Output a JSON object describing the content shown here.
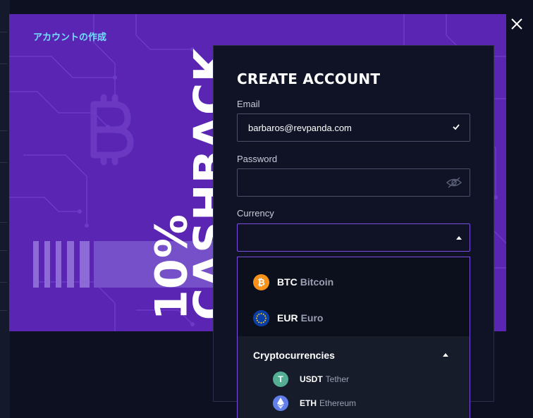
{
  "banner": {
    "title": "アカウントの作成",
    "promo_line1": "10%",
    "promo_line2": "CASHBACK"
  },
  "close": {
    "icon": "close-icon"
  },
  "form": {
    "title": "CREATE ACCOUNT",
    "email": {
      "label": "Email",
      "value": "barbaros@revpanda.com",
      "valid": true
    },
    "password": {
      "label": "Password",
      "value": ""
    },
    "currency": {
      "label": "Currency",
      "value": "",
      "expanded": true
    }
  },
  "dropdown": {
    "options": [
      {
        "code": "BTC",
        "name": "Bitcoin",
        "icon": "bitcoin-icon",
        "color": "#f7931a"
      },
      {
        "code": "EUR",
        "name": "Euro",
        "icon": "euro-flag-icon",
        "color": "#0b3fa8"
      }
    ],
    "group": {
      "label": "Cryptocurrencies",
      "items": [
        {
          "code": "USDT",
          "name": "Tether",
          "icon": "tether-icon",
          "color": "#53ae94"
        },
        {
          "code": "ETH",
          "name": "Ethereum",
          "icon": "ethereum-icon",
          "color": "#627eea"
        }
      ]
    }
  },
  "colors": {
    "page_bg": "#0c1020",
    "banner_purple": "#5a25b3",
    "panel_bg": "#0f1325",
    "accent_purple": "#7a4fe0",
    "title_cyan": "#6ee0ff"
  }
}
